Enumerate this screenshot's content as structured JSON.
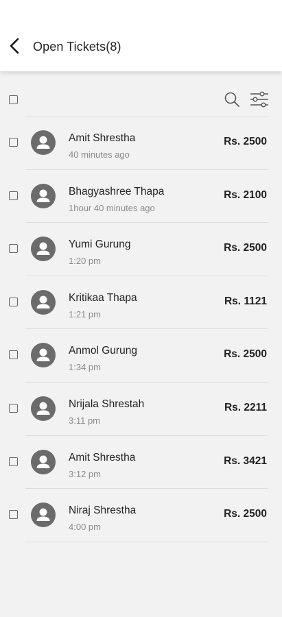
{
  "header": {
    "title": "Open Tickets(8)",
    "back_icon": "chevron-left-icon"
  },
  "toolbar": {
    "search_icon": "search-icon",
    "filter_icon": "sliders-icon"
  },
  "tickets": [
    {
      "name": "Amit Shrestha",
      "time": "40 minutes ago",
      "amount": "Rs. 2500"
    },
    {
      "name": "Bhagyashree Thapa",
      "time": "1hour 40 minutes ago",
      "amount": "Rs. 2100"
    },
    {
      "name": "Yumi Gurung",
      "time": "1:20 pm",
      "amount": "Rs. 2500"
    },
    {
      "name": "Kritikaa Thapa",
      "time": "1:21 pm",
      "amount": "Rs. 1121"
    },
    {
      "name": "Anmol Gurung",
      "time": "1:34 pm",
      "amount": "Rs. 2500"
    },
    {
      "name": "Nrijala Shrestah",
      "time": "3:11 pm",
      "amount": "Rs. 2211"
    },
    {
      "name": "Amit Shrestha",
      "time": "3:12 pm",
      "amount": "Rs. 3421"
    },
    {
      "name": "Niraj Shrestha",
      "time": "4:00 pm",
      "amount": "Rs. 2500"
    }
  ],
  "colors": {
    "background": "#f2f2f2",
    "header_background": "#ffffff",
    "avatar": "#6b6b6b",
    "secondary_text": "#8a8a8a"
  }
}
